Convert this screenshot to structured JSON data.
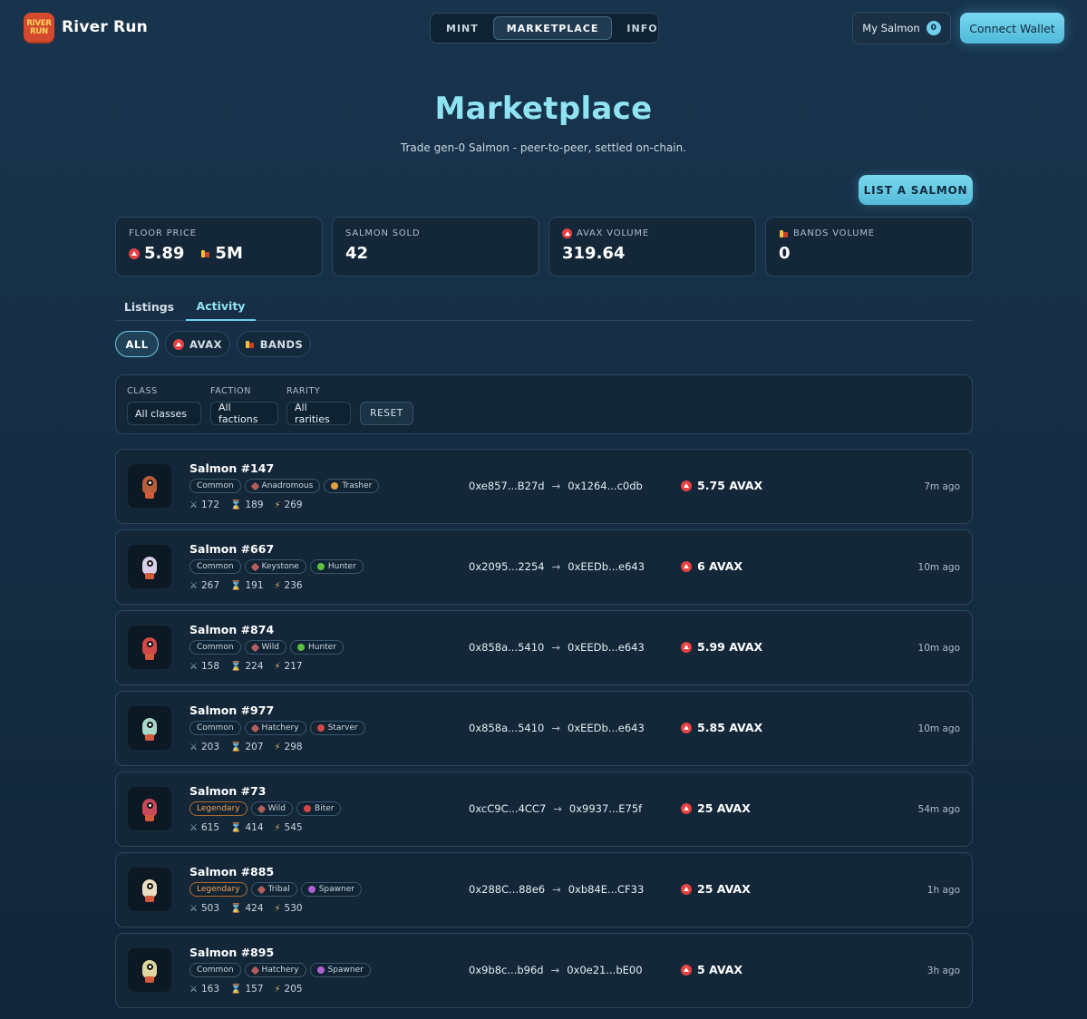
{
  "brand": {
    "logo_line1": "RIVER",
    "logo_line2": "RUN",
    "name": "River Run"
  },
  "nav": {
    "items": [
      "MINT",
      "MARKETPLACE",
      "INFO"
    ],
    "active": "MARKETPLACE"
  },
  "header": {
    "my_salmon_label": "My Salmon",
    "my_salmon_count": "0",
    "connect_label": "Connect Wallet"
  },
  "page": {
    "title": "Marketplace",
    "subtitle": "Trade gen-0 Salmon - peer-to-peer, settled on-chain.",
    "list_button": "LIST A SALMON"
  },
  "stats": [
    {
      "label": "FLOOR PRICE",
      "avax_value": "5.89",
      "bands_value": "5M"
    },
    {
      "label": "SALMON SOLD",
      "value": "42"
    },
    {
      "label": "AVAX VOLUME",
      "value": "319.64"
    },
    {
      "label": "BANDS VOLUME",
      "value": "0"
    }
  ],
  "tabs": [
    "Listings",
    "Activity"
  ],
  "active_tab": "Activity",
  "currency_filter": {
    "all": "ALL",
    "avax": "AVAX",
    "bands": "BANDS",
    "active": "ALL"
  },
  "filters": {
    "class_label": "CLASS",
    "class_value": "All classes",
    "faction_label": "FACTION",
    "faction_value": "All factions",
    "rarity_label": "RARITY",
    "rarity_value": "All rarities",
    "reset_label": "RESET"
  },
  "colors": {
    "accent": "#6fd0ec",
    "title": "#8fe3f2",
    "avax": "#e84142",
    "legendary": "#f0a45a"
  },
  "activity": [
    {
      "name": "Salmon #147",
      "rarity": "Common",
      "faction": "Anadromous",
      "class": "Trasher",
      "attack": "172",
      "time_stat": "189",
      "energy": "269",
      "from": "0xe857...B27d",
      "to": "0x1264...c0db",
      "price": "5.75 AVAX",
      "ago": "7m ago"
    },
    {
      "name": "Salmon #667",
      "rarity": "Common",
      "faction": "Keystone",
      "class": "Hunter",
      "attack": "267",
      "time_stat": "191",
      "energy": "236",
      "from": "0x2095...2254",
      "to": "0xEEDb...e643",
      "price": "6 AVAX",
      "ago": "10m ago"
    },
    {
      "name": "Salmon #874",
      "rarity": "Common",
      "faction": "Wild",
      "class": "Hunter",
      "attack": "158",
      "time_stat": "224",
      "energy": "217",
      "from": "0x858a...5410",
      "to": "0xEEDb...e643",
      "price": "5.99 AVAX",
      "ago": "10m ago"
    },
    {
      "name": "Salmon #977",
      "rarity": "Common",
      "faction": "Hatchery",
      "class": "Starver",
      "attack": "203",
      "time_stat": "207",
      "energy": "298",
      "from": "0x858a...5410",
      "to": "0xEEDb...e643",
      "price": "5.85 AVAX",
      "ago": "10m ago"
    },
    {
      "name": "Salmon #73",
      "rarity": "Legendary",
      "faction": "Wild",
      "class": "Biter",
      "attack": "615",
      "time_stat": "414",
      "energy": "545",
      "from": "0xcC9C...4CC7",
      "to": "0x9937...E75f",
      "price": "25 AVAX",
      "ago": "54m ago"
    },
    {
      "name": "Salmon #885",
      "rarity": "Legendary",
      "faction": "Tribal",
      "class": "Spawner",
      "attack": "503",
      "time_stat": "424",
      "energy": "530",
      "from": "0x288C...88e6",
      "to": "0xb84E...CF33",
      "price": "25 AVAX",
      "ago": "1h ago"
    },
    {
      "name": "Salmon #895",
      "rarity": "Common",
      "faction": "Hatchery",
      "class": "Spawner",
      "attack": "163",
      "time_stat": "157",
      "energy": "205",
      "from": "0x9b8c...b96d",
      "to": "0x0e21...bE00",
      "price": "5 AVAX",
      "ago": "3h ago"
    }
  ]
}
